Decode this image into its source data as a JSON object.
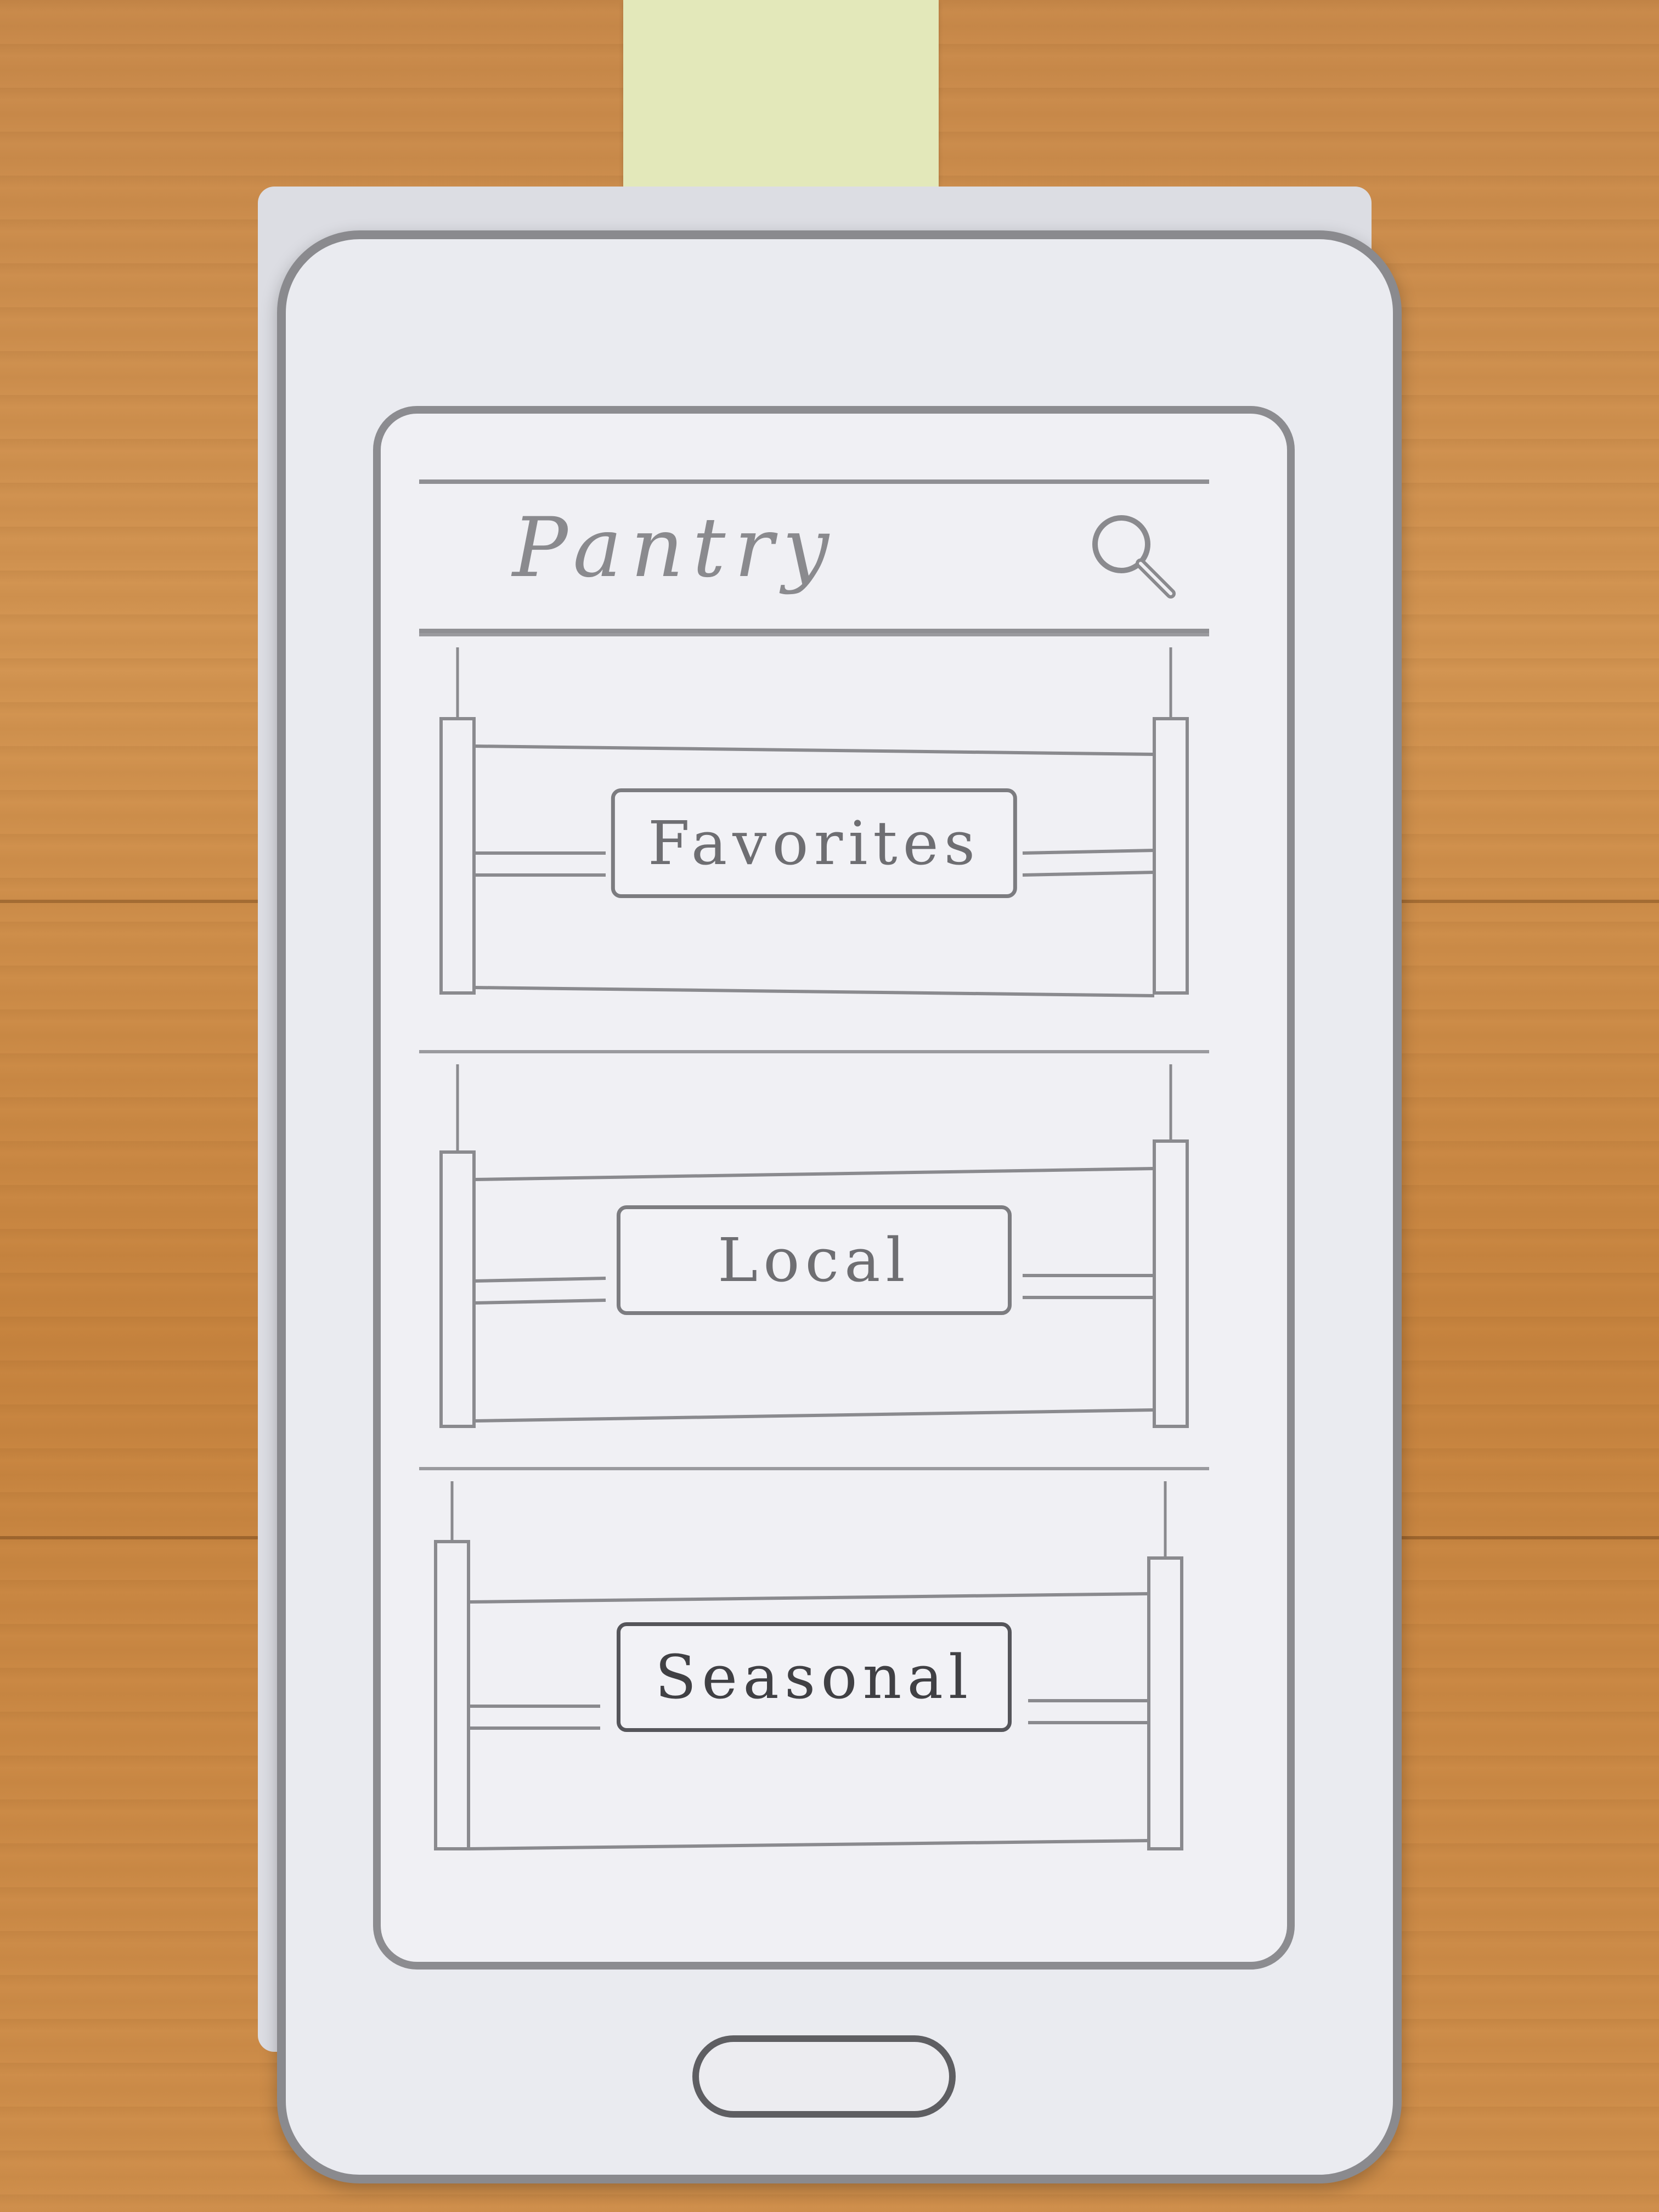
{
  "app_bar": {
    "title": "Pantry",
    "search_icon": "search-icon"
  },
  "shelves": [
    {
      "label": "Favorites"
    },
    {
      "label": "Local"
    },
    {
      "label": "Seasonal"
    }
  ],
  "device": {
    "home_icon": "home-button-icon"
  },
  "colors": {
    "pencil": "#8a8a8e",
    "paper": "#f0f0f4",
    "desk": "#c98a4b",
    "sticky_note": "#e3e8ba"
  }
}
